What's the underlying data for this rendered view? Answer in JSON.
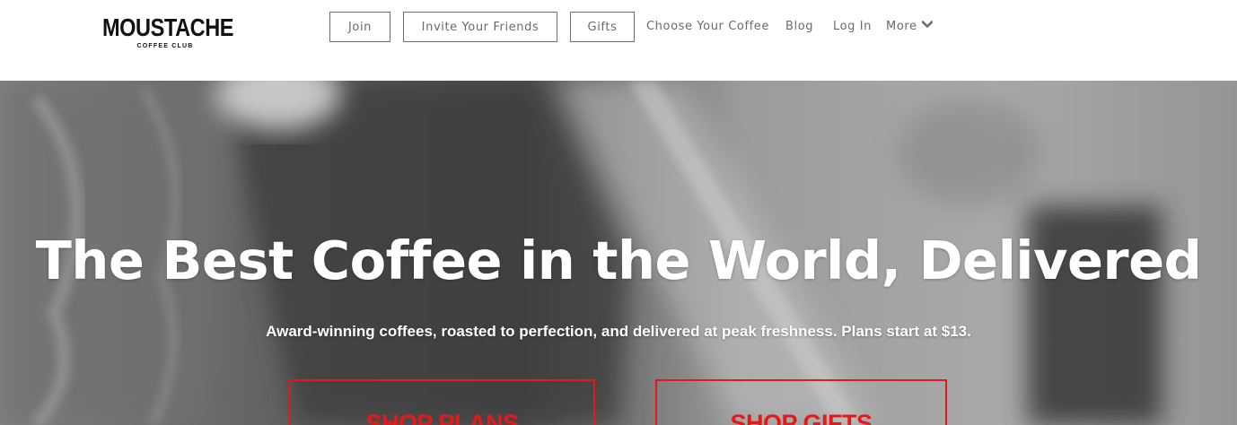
{
  "brand": {
    "name": "MOUSTACHE",
    "tagline": "COFFEE CLUB"
  },
  "nav": {
    "join": "Join",
    "invite": "Invite Your Friends",
    "gifts": "Gifts",
    "choose": "Choose Your Coffee",
    "blog": "Blog",
    "login": "Log In",
    "more": "More"
  },
  "hero": {
    "title": "The Best Coffee in the World, Delivered",
    "subtitle": "Award-winning coffees, roasted to perfection, and delivered at peak freshness. Plans start at $13.",
    "shop_plans": "SHOP PLANS",
    "shop_gifts": "SHOP GIFTS"
  },
  "colors": {
    "accent": "#e11b1b",
    "nav_text": "#6a6a6a",
    "logo": "#111111"
  },
  "icons": {
    "more": "chevron-down-icon"
  }
}
